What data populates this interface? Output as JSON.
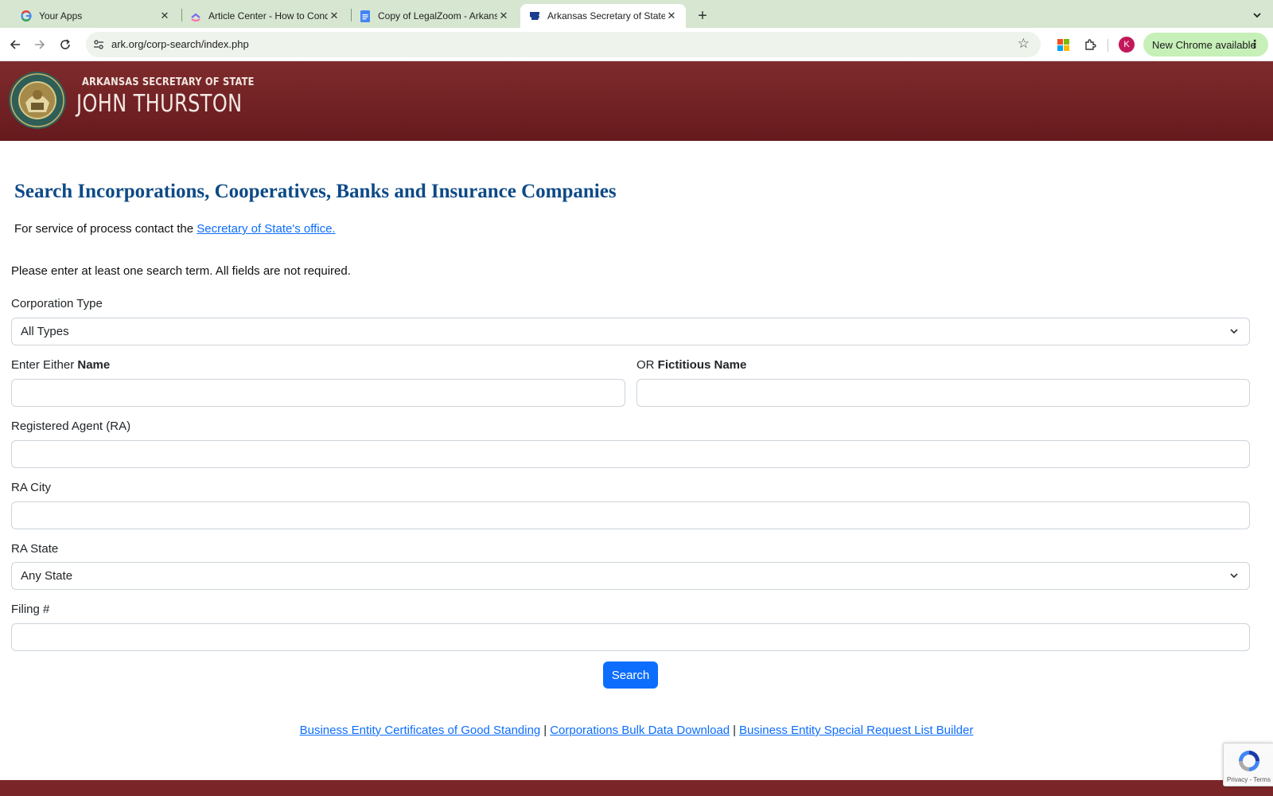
{
  "browser": {
    "tabs": [
      {
        "title": "Your Apps",
        "active": false
      },
      {
        "title": "Article Center - How to Condu",
        "active": false
      },
      {
        "title": "Copy of LegalZoom - Arkansa",
        "active": false
      },
      {
        "title": "Arkansas Secretary of State",
        "active": true
      }
    ],
    "url": "ark.org/corp-search/index.php",
    "profile_initial": "K",
    "update_label": "New Chrome available"
  },
  "banner": {
    "line1": "ARKANSAS SECRETARY OF STATE",
    "line2": "JOHN THURSTON",
    "colors": {
      "top": "#7f2b2d",
      "bottom": "#661a1d"
    }
  },
  "content": {
    "title": "Search Incorporations, Cooperatives, Banks and Insurance Companies",
    "service_prefix": "For service of process contact the ",
    "service_link": "Secretary of State's office.",
    "intro": "Please enter at least one search term. All fields are not required."
  },
  "form": {
    "corp_type_label": "Corporation Type",
    "corp_type_value": "All Types",
    "name_label_prefix": "Enter Either ",
    "name_label_bold": "Name",
    "fictitious_label_prefix": "OR ",
    "fictitious_label_bold": "Fictitious Name",
    "ra_label": "Registered Agent (RA)",
    "ra_city_label": "RA City",
    "ra_state_label": "RA State",
    "ra_state_value": "Any State",
    "filing_label": "Filing #",
    "search_label": "Search"
  },
  "footer": {
    "links": [
      "Business Entity Certificates of Good Standing",
      "Corporations Bulk Data Download",
      "Business Entity Special Request List Builder"
    ],
    "separator": "|"
  },
  "recaptcha": {
    "text": "Privacy - Terms"
  },
  "colors": {
    "primary": "#0d6efd",
    "title": "#0d4a86",
    "maroon": "#7a2628"
  }
}
